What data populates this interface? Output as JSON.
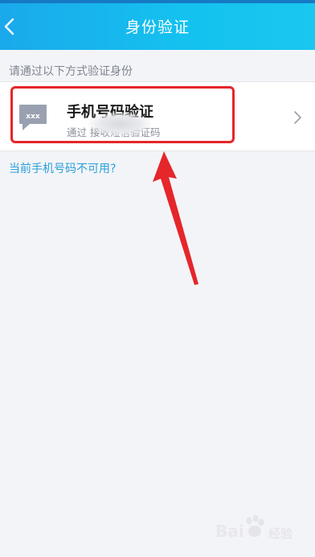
{
  "header": {
    "title": "身份验证"
  },
  "content": {
    "hint": "请通过以下方式验证身份",
    "option": {
      "title": "手机号码验证",
      "subtitle": "通过 接收短信验证码",
      "icon": "sms-bubble-icon"
    },
    "link": "当前手机号码不可用?"
  },
  "watermark": {
    "text": "Bai",
    "text2": "经验"
  },
  "colors": {
    "header": "#19b8ee",
    "link": "#2a9fd9",
    "highlight": "#e5262a"
  }
}
